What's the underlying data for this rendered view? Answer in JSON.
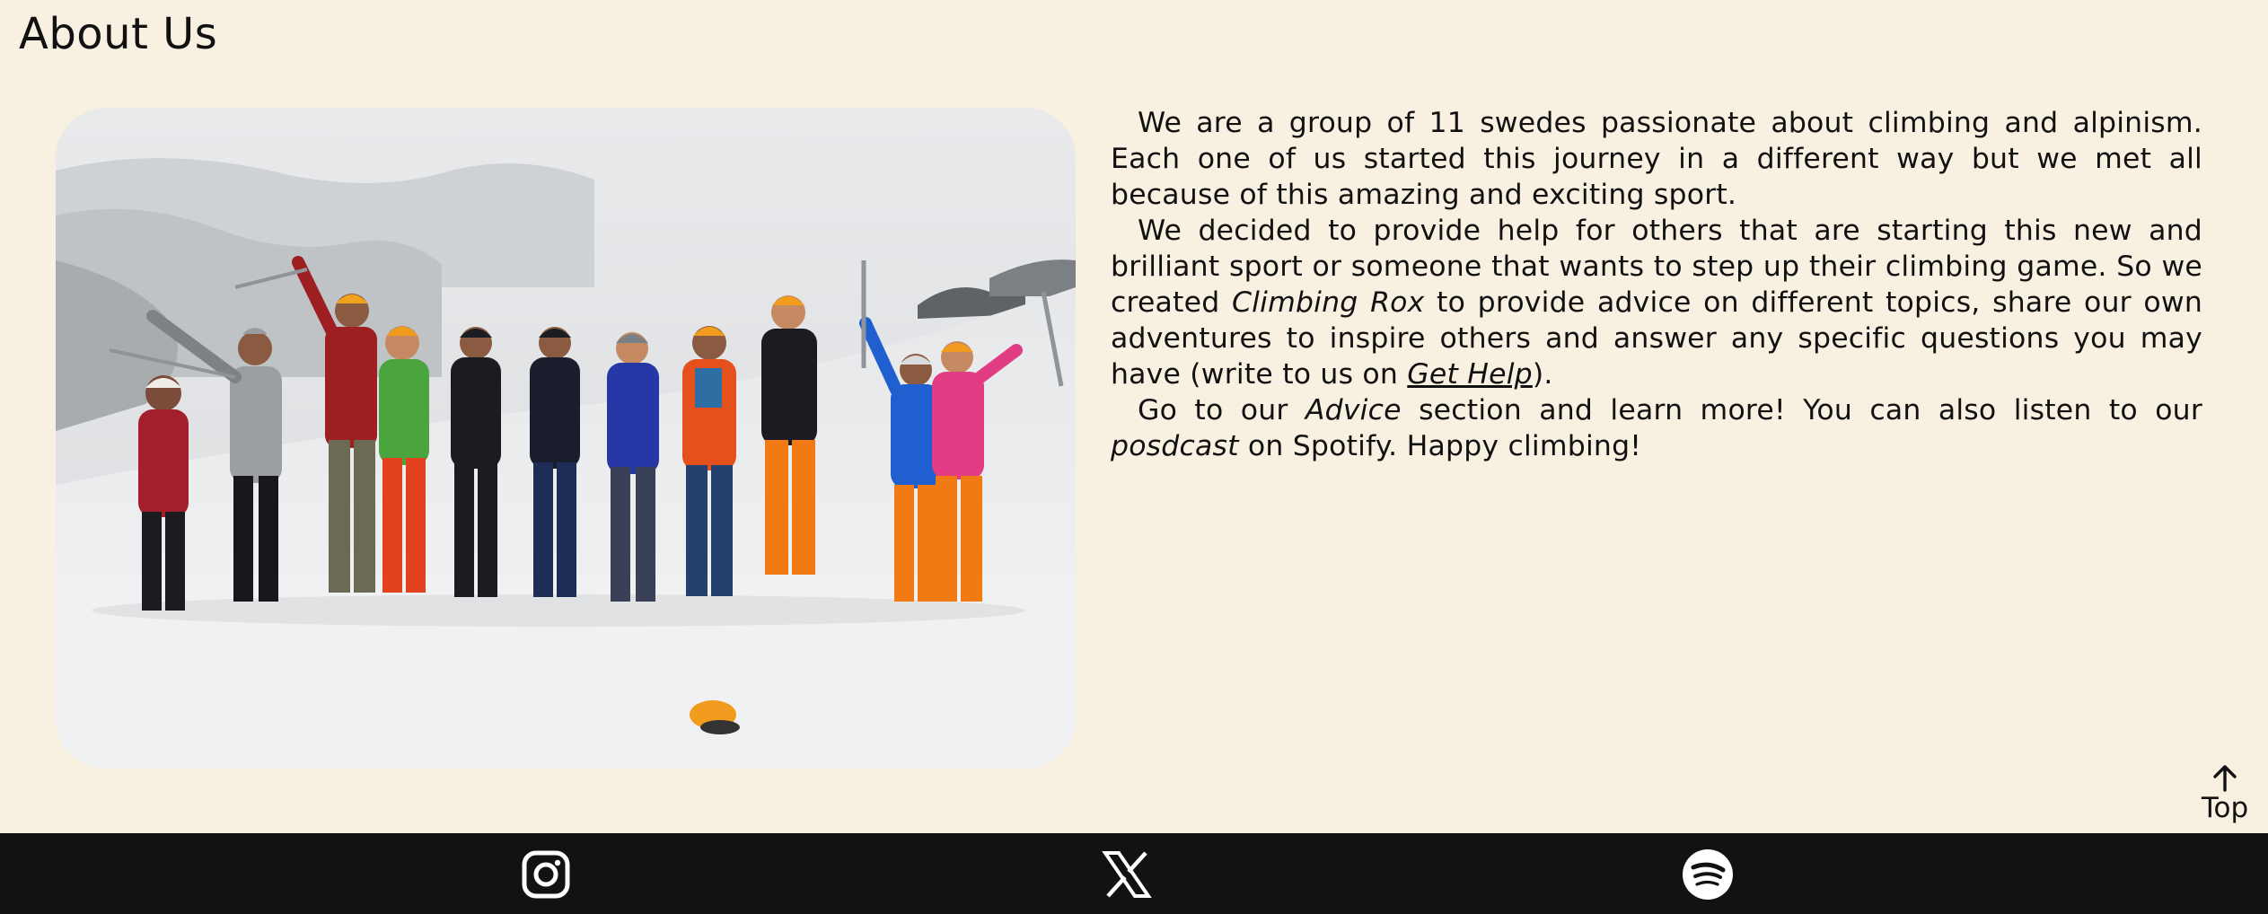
{
  "page": {
    "title": "About Us"
  },
  "about": {
    "p1": "We are a group of 11 swedes passionate about climbing and alpinism. Each one of us started this journey in a different way but we met all because of this amazing and exciting sport.",
    "p2_a": "We decided to provide help for others that are starting this new and brilliant sport or someone that wants to step up their climbing game. So we created ",
    "p2_brand": "Climbing Rox",
    "p2_b": " to provide advice on different topics, share our own adventures to inspire others and answer any specific questions you may have (write to us on ",
    "p2_link": "Get Help",
    "p2_c": ").",
    "p3_a": "Go to our ",
    "p3_advice": "Advice",
    "p3_b": " section and learn more! You can also listen to our ",
    "p3_podcast": "posdcast",
    "p3_c": " on Spotify. Happy climbing!"
  },
  "top_button": {
    "label": "Top",
    "icon": "arrow-up-icon"
  },
  "footer": {
    "icons": [
      "instagram-icon",
      "x-icon",
      "spotify-icon"
    ]
  },
  "colors": {
    "background": "#f8f0e0",
    "footer": "#121212",
    "text": "#111111"
  }
}
